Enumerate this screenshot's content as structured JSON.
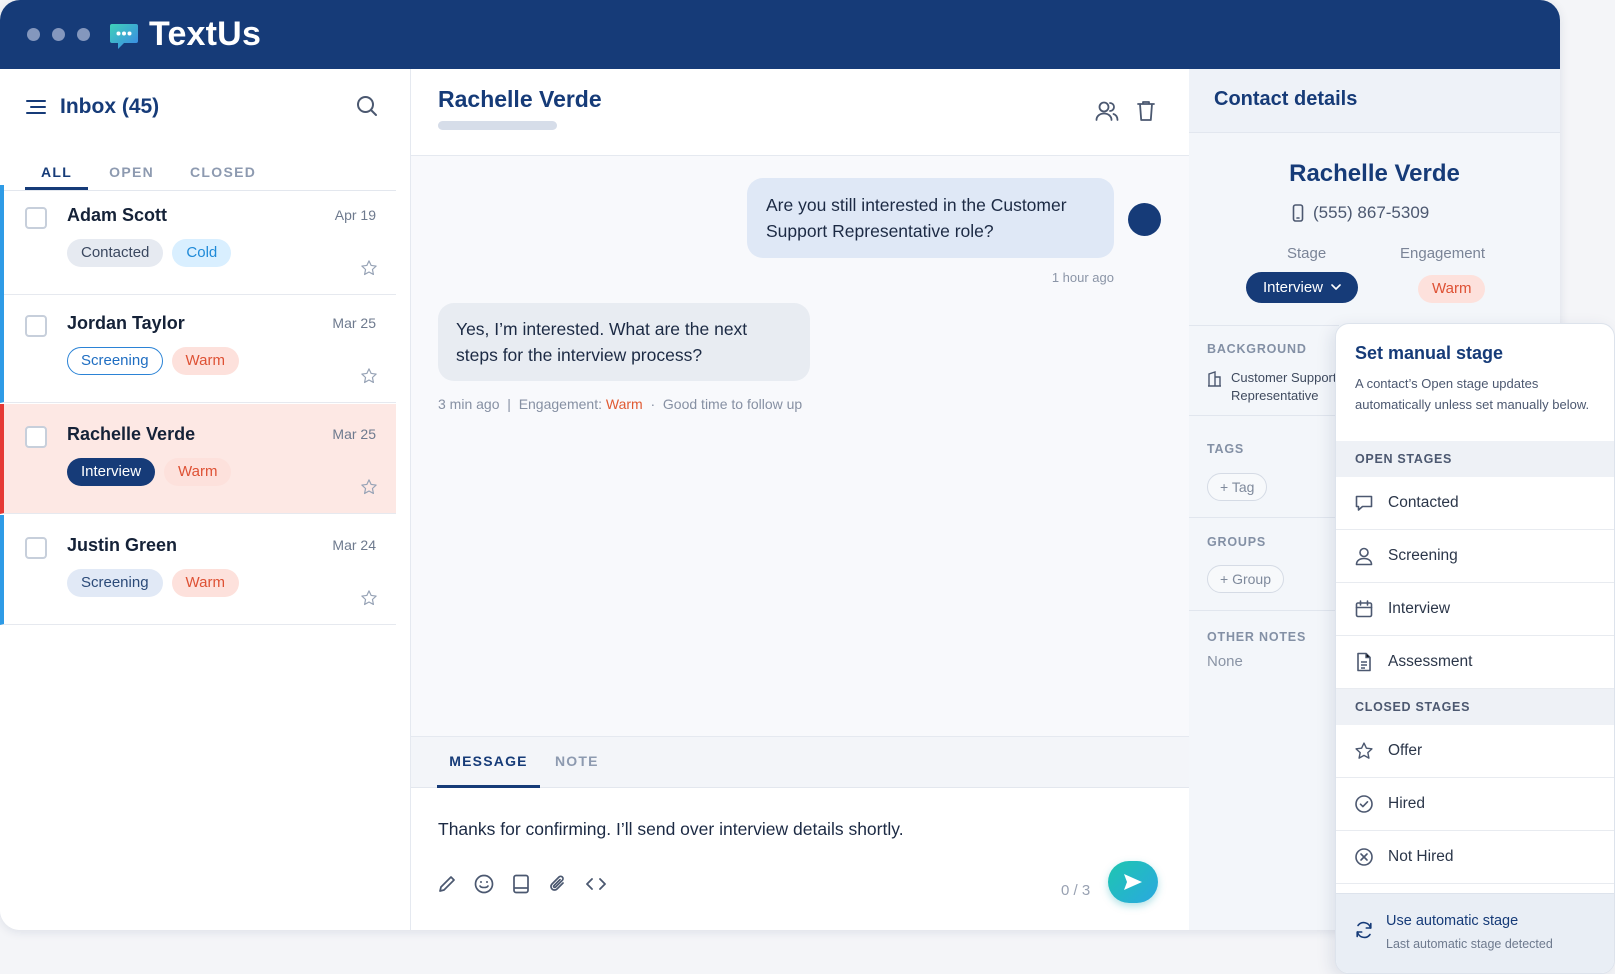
{
  "app": {
    "name": "TextUs"
  },
  "inbox": {
    "title": "Inbox (45)",
    "tabs": [
      "ALL",
      "OPEN",
      "CLOSED"
    ],
    "conversations": [
      {
        "name": "Adam Scott",
        "date": "Apr 19",
        "tags": [
          "Contacted",
          "Cold"
        ]
      },
      {
        "name": "Jordan Taylor",
        "date": "Mar 25",
        "tags": [
          "Screening",
          "Warm"
        ]
      },
      {
        "name": "Rachelle Verde",
        "date": "Mar 25",
        "tags": [
          "Interview",
          "Warm"
        ]
      },
      {
        "name": "Justin Green",
        "date": "Mar 24",
        "tags": [
          "Screening",
          "Warm"
        ]
      }
    ]
  },
  "chat": {
    "contact_name": "Rachelle Verde",
    "outgoing": {
      "text": "Are you still interested in the Customer Support Representative role?",
      "time": "1 hour ago"
    },
    "incoming": {
      "text": "Yes, I’m interested. What are the next steps for the interview process?",
      "time": "3 min ago",
      "engagement_label": "Engagement:",
      "engagement_value": "Warm",
      "hint": "Good time to follow up"
    }
  },
  "composer": {
    "tabs": [
      "MESSAGE",
      "NOTE"
    ],
    "text": "Thanks for confirming. I’ll send over interview details shortly.",
    "counter": "0 / 3"
  },
  "details": {
    "title": "Contact details",
    "name": "Rachelle Verde",
    "phone": "(555) 867-5309",
    "stage_label": "Stage",
    "stage_value": "Interview",
    "engagement_label": "Engagement",
    "engagement_value": "Warm",
    "background_label": "BACKGROUND",
    "background_value": "Customer Support Representative",
    "tags_label": "TAGS",
    "tag_button": "Tag",
    "groups_label": "GROUPS",
    "group_button": "Group",
    "notes_label": "OTHER NOTES",
    "notes_value": "None"
  },
  "stage_menu": {
    "title": "Set manual stage",
    "description": "A contact’s Open stage updates automatically unless set manually below.",
    "open_label": "OPEN STAGES",
    "open_items": [
      "Contacted",
      "Screening",
      "Interview",
      "Assessment"
    ],
    "closed_label": "CLOSED STAGES",
    "closed_items": [
      "Offer",
      "Hired",
      "Not Hired"
    ],
    "auto_title": "Use automatic stage",
    "auto_sub": "Last automatic stage detected"
  },
  "colors": {
    "brand": "#163b78",
    "warm": "#de5134",
    "cold": "#1f8ad8",
    "selected_row": "#fde8e4",
    "accent_left": "#2e9be6"
  },
  "icons": [
    "menu-icon",
    "search-icon",
    "star-icon",
    "contacts-icon",
    "trash-icon",
    "edit-icon",
    "emoji-icon",
    "template-icon",
    "attach-icon",
    "code-icon",
    "send-icon",
    "phone-icon",
    "building-icon",
    "chat-icon",
    "user-icon",
    "calendar-icon",
    "document-icon",
    "check-circle-icon",
    "x-circle-icon",
    "refresh-icon",
    "chevron-down-icon"
  ]
}
